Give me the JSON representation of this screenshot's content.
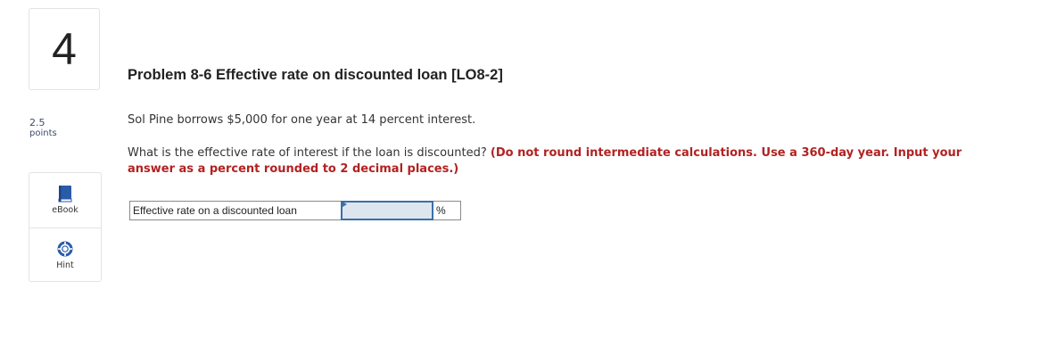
{
  "question": {
    "number": "4",
    "points_value": "2.5",
    "points_label": "points"
  },
  "tools": {
    "ebook_label": "eBook",
    "hint_label": "Hint",
    "ebook_icon": "book-icon",
    "hint_icon": "lifebuoy-icon"
  },
  "problem": {
    "title": "Problem 8-6 Effective rate on discounted loan [LO8-2]",
    "statement": "Sol Pine borrows $5,000 for one year at 14 percent interest.",
    "question_text": "What is the effective rate of interest if the loan is discounted? ",
    "instructions": "(Do not round intermediate calculations. Use a 360-day year. Input your answer as a percent rounded to 2 decimal places.)"
  },
  "answer": {
    "label": "Effective rate on a discounted loan",
    "value": "",
    "unit": "%"
  },
  "colors": {
    "instruction_red": "#b22222",
    "input_border_blue": "#3a6fa8",
    "input_fill": "#dde6ef",
    "tool_icon_blue": "#2a5ba8"
  }
}
